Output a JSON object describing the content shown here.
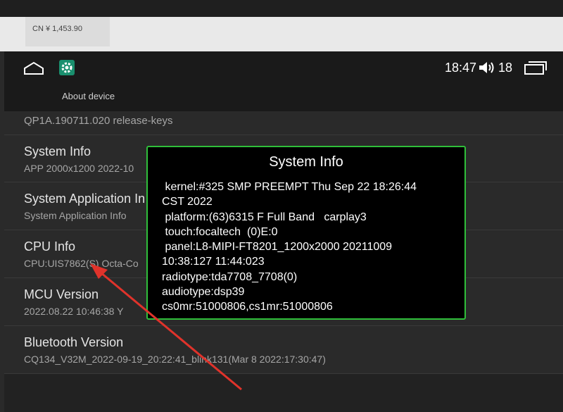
{
  "background": {
    "price_text": "CN ¥  1,453.90"
  },
  "statusbar": {
    "clock": "18:47",
    "volume_level": "18",
    "app_title": "About device"
  },
  "list": [
    {
      "title": "",
      "subtitle": "QP1A.190711.020 release-keys"
    },
    {
      "title": "System Info",
      "subtitle": "APP 2000x1200 2022-10"
    },
    {
      "title": "System Application In",
      "subtitle": "System Application Info"
    },
    {
      "title": "CPU Info",
      "subtitle": "CPU:UIS7862(S) Octa-Co"
    },
    {
      "title": "MCU Version",
      "subtitle": "2022.08.22 10:46:38 Y"
    },
    {
      "title": "Bluetooth Version",
      "subtitle": "CQ134_V32M_2022-09-19_20:22:41_blink131(Mar  8 2022:17:30:47)"
    }
  ],
  "dialog": {
    "title": "System Info",
    "lines": [
      " kernel:#325 SMP PREEMPT Thu Sep 22 18:26:44",
      "CST 2022",
      " platform:(63)6315 F Full Band   carplay3",
      " touch:focaltech  (0)E:0",
      " panel:L8-MIPI-FT8201_1200x2000 20211009",
      "10:38:127 11:44:023",
      "radiotype:tda7708_7708(0)",
      "audiotype:dsp39",
      "cs0mr:51000806,cs1mr:51000806"
    ]
  },
  "colors": {
    "dialog_border": "#2fbf3a",
    "arrow": "#e0332b",
    "settings_icon_bg": "#1a8f6e"
  },
  "icons": {
    "home": "home-icon",
    "settings": "settings-gear-icon",
    "volume": "volume-icon",
    "recents": "recent-apps-icon"
  }
}
